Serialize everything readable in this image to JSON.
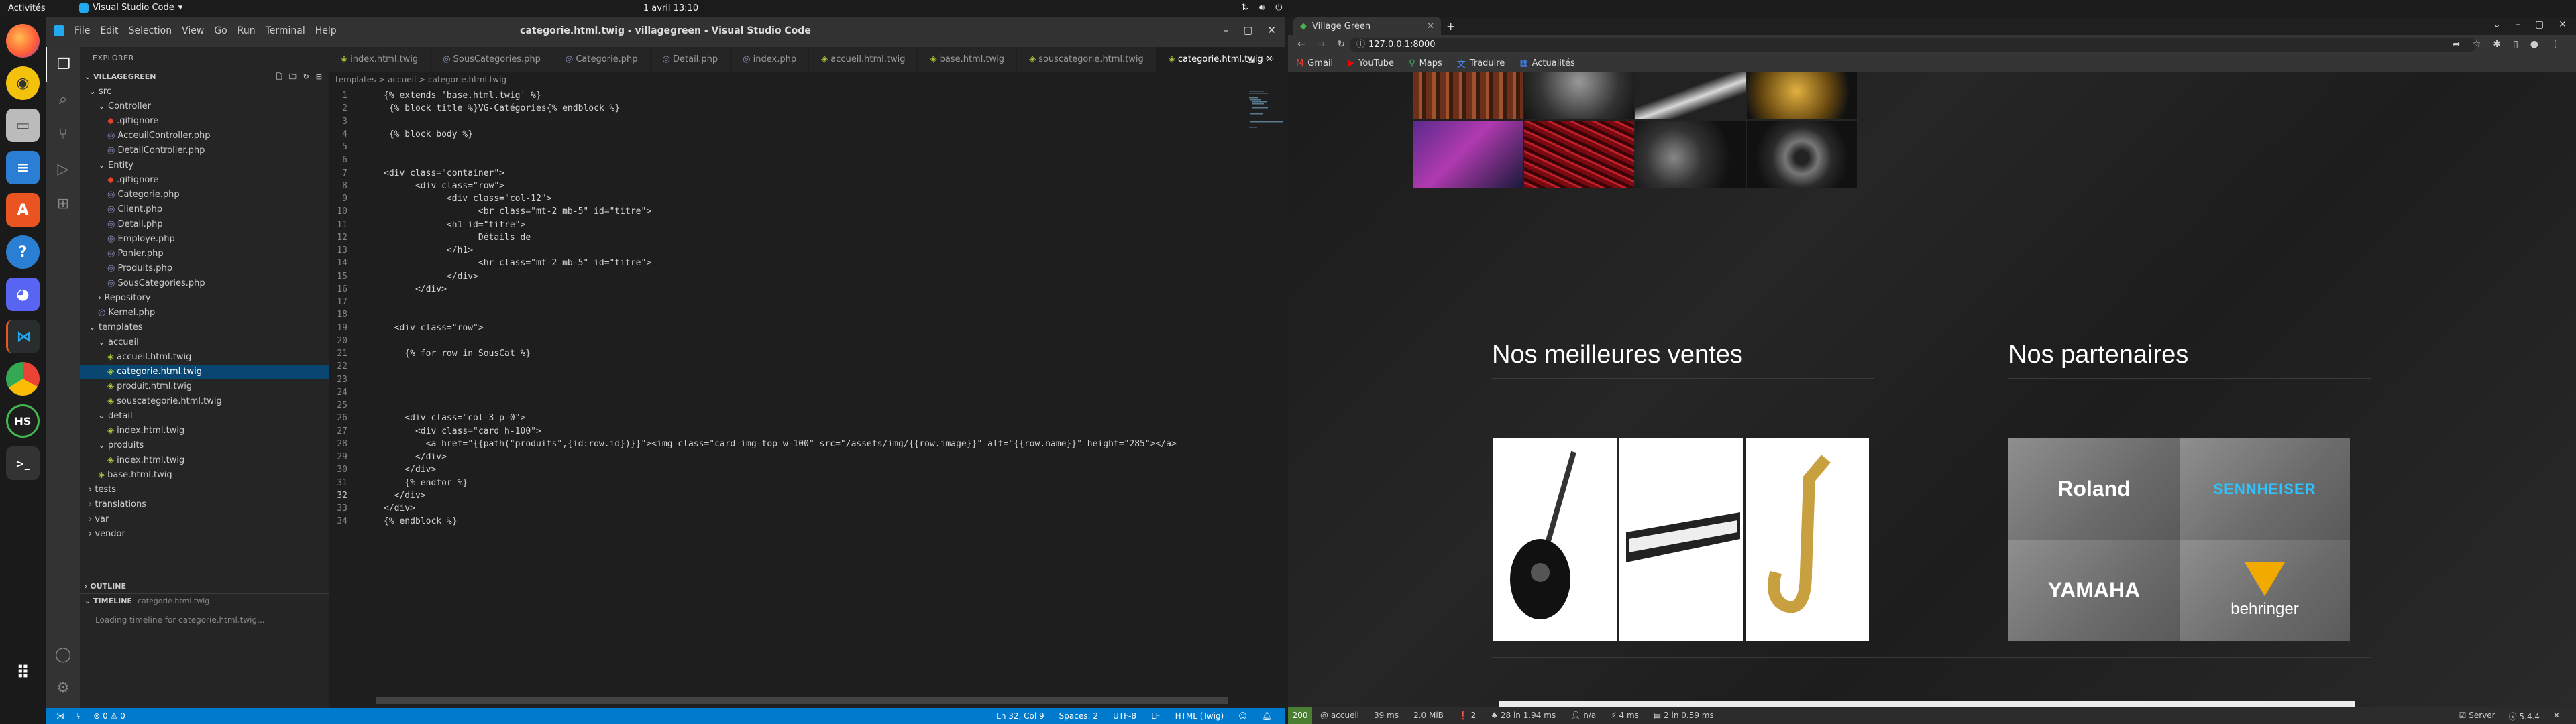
{
  "topbar": {
    "activities": "Activités",
    "app_name": "Visual Studio Code",
    "clock": "1 avril 13:10"
  },
  "dock": {
    "icons": [
      "firefox-icon",
      "rhythmbox-icon",
      "files-icon",
      "writer-icon",
      "software-icon",
      "help-icon",
      "discord-icon",
      "vscode-icon",
      "chrome-icon",
      "hs-icon",
      "terminal-icon",
      "apps-grid-icon"
    ],
    "hs_label": "HS"
  },
  "vscode": {
    "menu": [
      "File",
      "Edit",
      "Selection",
      "View",
      "Go",
      "Run",
      "Terminal",
      "Help"
    ],
    "window_title": "categorie.html.twig - villagegreen - Visual Studio Code",
    "explorer_label": "EXPLORER",
    "project": "VILLAGEGREEN",
    "tree": [
      {
        "label": "src",
        "depth": 0,
        "kind": "folder-open"
      },
      {
        "label": "Controller",
        "depth": 1,
        "kind": "folder-open"
      },
      {
        "label": ".gitignore",
        "depth": 2,
        "kind": "git"
      },
      {
        "label": "AcceuilController.php",
        "depth": 2,
        "kind": "php"
      },
      {
        "label": "DetailController.php",
        "depth": 2,
        "kind": "php"
      },
      {
        "label": "Entity",
        "depth": 1,
        "kind": "folder-open"
      },
      {
        "label": ".gitignore",
        "depth": 2,
        "kind": "git"
      },
      {
        "label": "Categorie.php",
        "depth": 2,
        "kind": "php"
      },
      {
        "label": "Client.php",
        "depth": 2,
        "kind": "php"
      },
      {
        "label": "Detail.php",
        "depth": 2,
        "kind": "php"
      },
      {
        "label": "Employe.php",
        "depth": 2,
        "kind": "php"
      },
      {
        "label": "Panier.php",
        "depth": 2,
        "kind": "php"
      },
      {
        "label": "Produits.php",
        "depth": 2,
        "kind": "php"
      },
      {
        "label": "SousCategories.php",
        "depth": 2,
        "kind": "php"
      },
      {
        "label": "Repository",
        "depth": 1,
        "kind": "folder"
      },
      {
        "label": "Kernel.php",
        "depth": 1,
        "kind": "php"
      },
      {
        "label": "templates",
        "depth": 0,
        "kind": "folder-open"
      },
      {
        "label": "accueil",
        "depth": 1,
        "kind": "folder-open"
      },
      {
        "label": "accueil.html.twig",
        "depth": 2,
        "kind": "twig"
      },
      {
        "label": "categorie.html.twig",
        "depth": 2,
        "kind": "twig",
        "selected": true
      },
      {
        "label": "produit.html.twig",
        "depth": 2,
        "kind": "twig"
      },
      {
        "label": "souscategorie.html.twig",
        "depth": 2,
        "kind": "twig"
      },
      {
        "label": "detail",
        "depth": 1,
        "kind": "folder-open"
      },
      {
        "label": "index.html.twig",
        "depth": 2,
        "kind": "twig"
      },
      {
        "label": "produits",
        "depth": 1,
        "kind": "folder-open"
      },
      {
        "label": "index.html.twig",
        "depth": 2,
        "kind": "twig"
      },
      {
        "label": "base.html.twig",
        "depth": 1,
        "kind": "twig"
      },
      {
        "label": "tests",
        "depth": 0,
        "kind": "folder"
      },
      {
        "label": "translations",
        "depth": 0,
        "kind": "folder"
      },
      {
        "label": "var",
        "depth": 0,
        "kind": "folder"
      },
      {
        "label": "vendor",
        "depth": 0,
        "kind": "folder"
      }
    ],
    "outline_label": "OUTLINE",
    "timeline_label": "TIMELINE",
    "timeline_file": "categorie.html.twig",
    "timeline_msg": "Loading timeline for categorie.html.twig...",
    "tabs": [
      {
        "label": "index.html.twig",
        "icon": "twig"
      },
      {
        "label": "SousCategories.php",
        "icon": "php"
      },
      {
        "label": "Categorie.php",
        "icon": "php"
      },
      {
        "label": "Detail.php",
        "icon": "php"
      },
      {
        "label": "index.php",
        "icon": "php"
      },
      {
        "label": "accueil.html.twig",
        "icon": "twig"
      },
      {
        "label": "base.html.twig",
        "icon": "twig"
      },
      {
        "label": "souscategorie.html.twig",
        "icon": "twig"
      },
      {
        "label": "categorie.html.twig",
        "icon": "twig",
        "active": true
      }
    ],
    "breadcrumb": "templates > accueil > categorie.html.twig",
    "code": [
      "{% extends 'base.html.twig' %}",
      " {% block title %}VG-Catégories{% endblock %}",
      "",
      " {% block body %}",
      "",
      "",
      "<div class=\"container\">",
      "      <div class=\"row\">",
      "            <div class=\"col-12\">",
      "                  <br class=\"mt-2 mb-5\" id=\"titre\">",
      "            <h1 id=\"titre\">",
      "                  Détails de",
      "            </h1>",
      "                  <hr class=\"mt-2 mb-5\" id=\"titre\">",
      "            </div>",
      "      </div>",
      "",
      "",
      "  <div class=\"row\">",
      "",
      "    {% for row in SousCat %}",
      "",
      "",
      "",
      "",
      "    <div class=\"col-3 p-0\">",
      "      <div class=\"card h-100\">",
      "        <a href=\"{{path(\"produits\",{id:row.id})}}\"><img class=\"card-img-top w-100\" src=\"/assets/img/{{row.image}}\" alt=\"{{row.name}}\" height=\"285\"></a>",
      "      </div>",
      "    </div>",
      "    {% endfor %}",
      "  </div>",
      "</div>",
      "{% endblock %}"
    ],
    "status_left": [
      "⑂",
      "⊗ 0 ⚠ 0"
    ],
    "status_right": [
      "Ln 32, Col 9",
      "Spaces: 2",
      "UTF-8",
      "LF",
      "HTML (Twig)"
    ]
  },
  "browser": {
    "tab_title": "Village Green",
    "url": "127.0.0.1:8000",
    "bookmarks": [
      "Gmail",
      "YouTube",
      "Maps",
      "Traduire",
      "Actualités"
    ],
    "heading_best": "Nos meilleures ventes",
    "heading_partners": "Nos partenaires",
    "products": [
      "guitar-image",
      "keyboard-image",
      "saxophone-image"
    ],
    "partners": [
      "Roland",
      "SENNHEISER",
      "YAMAHA",
      "behringer"
    ],
    "status": {
      "code": "200",
      "route": "@ accueil",
      "time": "39 ms",
      "memory": "2.0 MiB",
      "queries_count": "2",
      "twig": "28 in 1.94 ms",
      "user": "n/a",
      "ajax": "4 ms",
      "db": "2 in 0.59 ms",
      "server": "Server",
      "version": "5.4.4"
    }
  }
}
